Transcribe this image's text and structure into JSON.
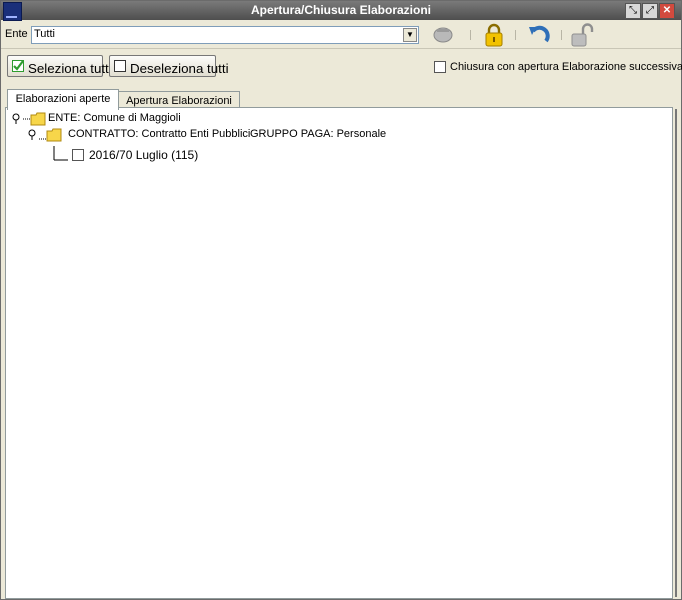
{
  "window": {
    "title": "Apertura/Chiusura Elaborazioni"
  },
  "toolbar": {
    "ente_label": "Ente",
    "ente_value": "Tutti",
    "icons": [
      "disabled-round-icon",
      "padlock-closed-icon",
      "undo-arrow-icon",
      "padlock-open-icon"
    ]
  },
  "actions": {
    "select_all": "Seleziona tutti",
    "deselect_all": "Deseleziona tutti",
    "close_with_next_label": "Chiusura con apertura Elaborazione successiva"
  },
  "tabs": [
    {
      "label": "Elaborazioni aperte",
      "active": true
    },
    {
      "label": "Apertura Elaborazioni",
      "active": false
    }
  ],
  "tree": {
    "ente": "ENTE: Comune di Maggioli",
    "contratto": "CONTRATTO: Contratto Enti Pubblici",
    "gruppo": "GRUPPO PAGA: Personale",
    "elaborazione": "2016/70  Luglio (115)"
  },
  "colors": {
    "titlebar": "#5c5c5c",
    "panel": "#ffffff",
    "chrome": "#ece9d8",
    "check_green": "#2e9c2e"
  }
}
